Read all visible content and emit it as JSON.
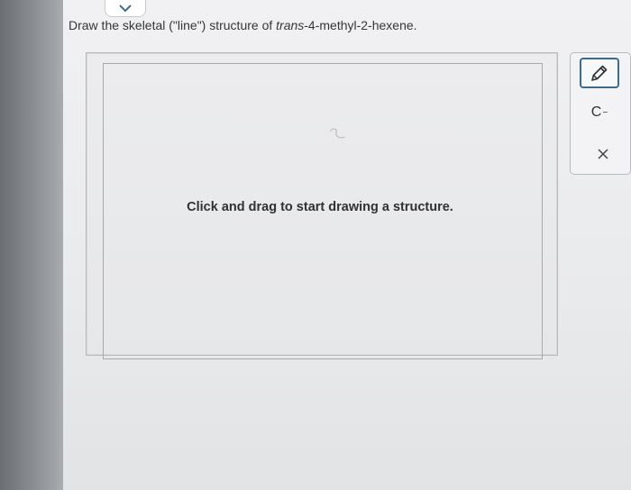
{
  "question": {
    "prefix": "Draw the skeletal (\"line\") structure of ",
    "compound_italic": "trans",
    "compound_rest": "-4-methyl-2-hexene."
  },
  "canvas": {
    "hint": "Click and drag to start drawing a structure."
  },
  "toolbar": {
    "pencil_icon": "pencil-icon",
    "charge_label": "C",
    "charge_sign": "−",
    "clear_icon": "close-icon"
  },
  "nav": {
    "chevron_icon": "chevron-down-icon"
  },
  "colors": {
    "accent": "#3d6b8f"
  }
}
